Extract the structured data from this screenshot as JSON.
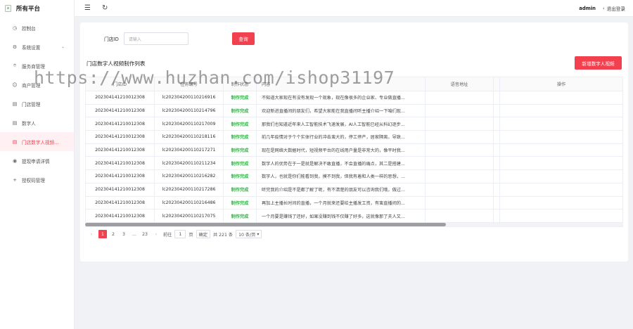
{
  "brand": {
    "title": "所有平台"
  },
  "sidebar": {
    "items": [
      {
        "label": "控制台",
        "icon": "◷"
      },
      {
        "label": "系统设置",
        "icon": "⚙",
        "has_children": true
      },
      {
        "label": "服务商管理",
        "icon": "⌾"
      },
      {
        "label": "商户管理",
        "icon": "☺"
      },
      {
        "label": "门店管理",
        "icon": "▤"
      },
      {
        "label": "数字人",
        "icon": "▤"
      },
      {
        "label": "门店数字人视频...",
        "icon": "▤",
        "active": true
      },
      {
        "label": "提现申请详情",
        "icon": "◉"
      },
      {
        "label": "授权码管理",
        "icon": "+"
      }
    ]
  },
  "topbar": {
    "user": "admin",
    "logout": "退出登录"
  },
  "filter": {
    "label": "门店ID",
    "placeholder": "请输入",
    "query_button": "查询"
  },
  "list": {
    "title": "门店数字人视频制作列表",
    "add_button": "新增数字人视频"
  },
  "table": {
    "columns": [
      "门店ID",
      "任务编号",
      "制作状态",
      "内容",
      "语音地址",
      "",
      "操作"
    ],
    "rows": [
      {
        "store_id": "2023041412100123​08",
        "task_id": "lc202304200110216916",
        "status": "制作完成",
        "content": "不知道大家现在有没有发现一个现象，现在像很多的企业家、专业做直播..."
      },
      {
        "store_id": "202304141210012308",
        "task_id": "lc202304200110214796",
        "status": "制作完成",
        "content": "欢迎新进直播间的朋友们，希望大家能在我直播间听主播介绍一下咱们现..."
      },
      {
        "store_id": "202304141210012308",
        "task_id": "lc202304200110217009",
        "status": "制作完成",
        "content": "那我们也知道近年来人工智能技术飞速发展，AI人工智能已经从科幻逐步..."
      },
      {
        "store_id": "202304141210012308",
        "task_id": "lc202304200110218116",
        "status": "制作完成",
        "content": "前几年疫情对于个个实体行业的冲击蛮大的，停工停产，居家隔离，导致..."
      },
      {
        "store_id": "202304141210012308",
        "task_id": "lc202304200110217271",
        "status": "制作完成",
        "content": "现在是网络大数据时代，短视频平台的在线用户量是非常大的，像平时我..."
      },
      {
        "store_id": "202304141210012308",
        "task_id": "lc202304200110211234",
        "status": "制作完成",
        "content": "数字人的优势在于一是就是解决不敢直播，不会直播的痛点，其二是搭建..."
      },
      {
        "store_id": "202304141210012308",
        "task_id": "lc202304200110216282",
        "status": "制作完成",
        "content": "数字人，也就是你们能看到我，摸不到我，但我有着和人类一样的思想，..."
      },
      {
        "store_id": "202304141210012308",
        "task_id": "lc202304200110217286",
        "status": "制作完成",
        "content": "听完我的介绍是不是都了解了呢，有不清楚的朋友可以咨询我们哦，做过..."
      },
      {
        "store_id": "202304141210012308",
        "task_id": "lc202304200110216486",
        "status": "制作完成",
        "content": "再加上主播长时间的直播，一个月就来还要给主播发工资，有蛮直播间的..."
      },
      {
        "store_id": "202304141210012308",
        "task_id": "lc202304200110217075",
        "status": "制作完成",
        "content": "一个月要是赚钱了还好，如果没赚到钱不仅赚了好多，这就像那了夫人又..."
      }
    ]
  },
  "pagination": {
    "pages": [
      "1",
      "2",
      "3",
      "...",
      "23"
    ],
    "active": "1",
    "goto_label": "前往",
    "goto_value": "1",
    "page_unit": "页",
    "confirm": "确定",
    "total": "共 221 条",
    "page_size": "10 条/页"
  },
  "watermark": "https://www.huzhan.com/ishop31197"
}
